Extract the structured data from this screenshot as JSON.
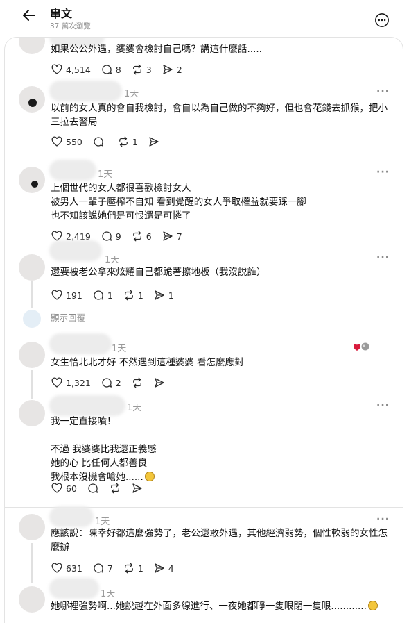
{
  "header": {
    "title": "串文",
    "views": "37 萬次瀏覽"
  },
  "posts": [
    {
      "text": "如果公公外遇，婆婆會檢討自己嗎？講這什麼話.....",
      "likes": "4,514",
      "comments": "8",
      "reposts": "3",
      "shares": "2"
    },
    {
      "time": "1天",
      "text": "以前的女人真的會自我檢討，會自以為自己做的不夠好，但也會花錢去抓猴，把小三拉去警局",
      "likes": "550",
      "comments": "",
      "reposts": "1",
      "shares": ""
    },
    {
      "time": "1天",
      "text": "上個世代的女人都很喜歡檢討女人\n被男人一輩子壓榨不自知 看到覺醒的女人爭取權益就要踩一腳\n也不知該說她們是可恨還是可憐了",
      "likes": "2,419",
      "comments": "9",
      "reposts": "6",
      "shares": "7"
    },
    {
      "time": "1天",
      "text": "還要被老公拿來炫耀自己都跪著擦地板（我沒說誰）",
      "likes": "191",
      "comments": "1",
      "reposts": "1",
      "shares": "1"
    },
    {
      "time": "1天",
      "text": "女生恰北北才好 不然遇到這種婆婆 看怎麼應對",
      "likes": "1,321",
      "comments": "2",
      "reposts": "",
      "shares": ""
    },
    {
      "time": "1天",
      "text": "我一定直接噴！\n\n不過 我婆婆比我還正義感\n她的心 比任何人都善良\n我根本沒機會嗆她......",
      "likes": "60",
      "comments": "",
      "reposts": "",
      "shares": ""
    },
    {
      "time": "1天",
      "text": "應該說：陳幸好都這麼強勢了，老公還敢外遇，其他經濟弱勢，個性軟弱的女性怎麼辦",
      "likes": "631",
      "comments": "7",
      "reposts": "1",
      "shares": "4"
    },
    {
      "time": "1天",
      "text": "她哪裡強勢啊...她說越在外面多線進行、一夜她都睜一隻眼閉一隻眼............"
    }
  ],
  "show_replies": "顯示回覆",
  "icons": {
    "back": "arrow-left-icon",
    "more": "more-circle-icon",
    "like": "heart-icon",
    "comment": "comment-icon",
    "repost": "repost-icon",
    "share": "send-icon"
  },
  "colors": {
    "text": "#101010",
    "muted": "#8a8a8a",
    "divider": "#e3e3e3"
  }
}
